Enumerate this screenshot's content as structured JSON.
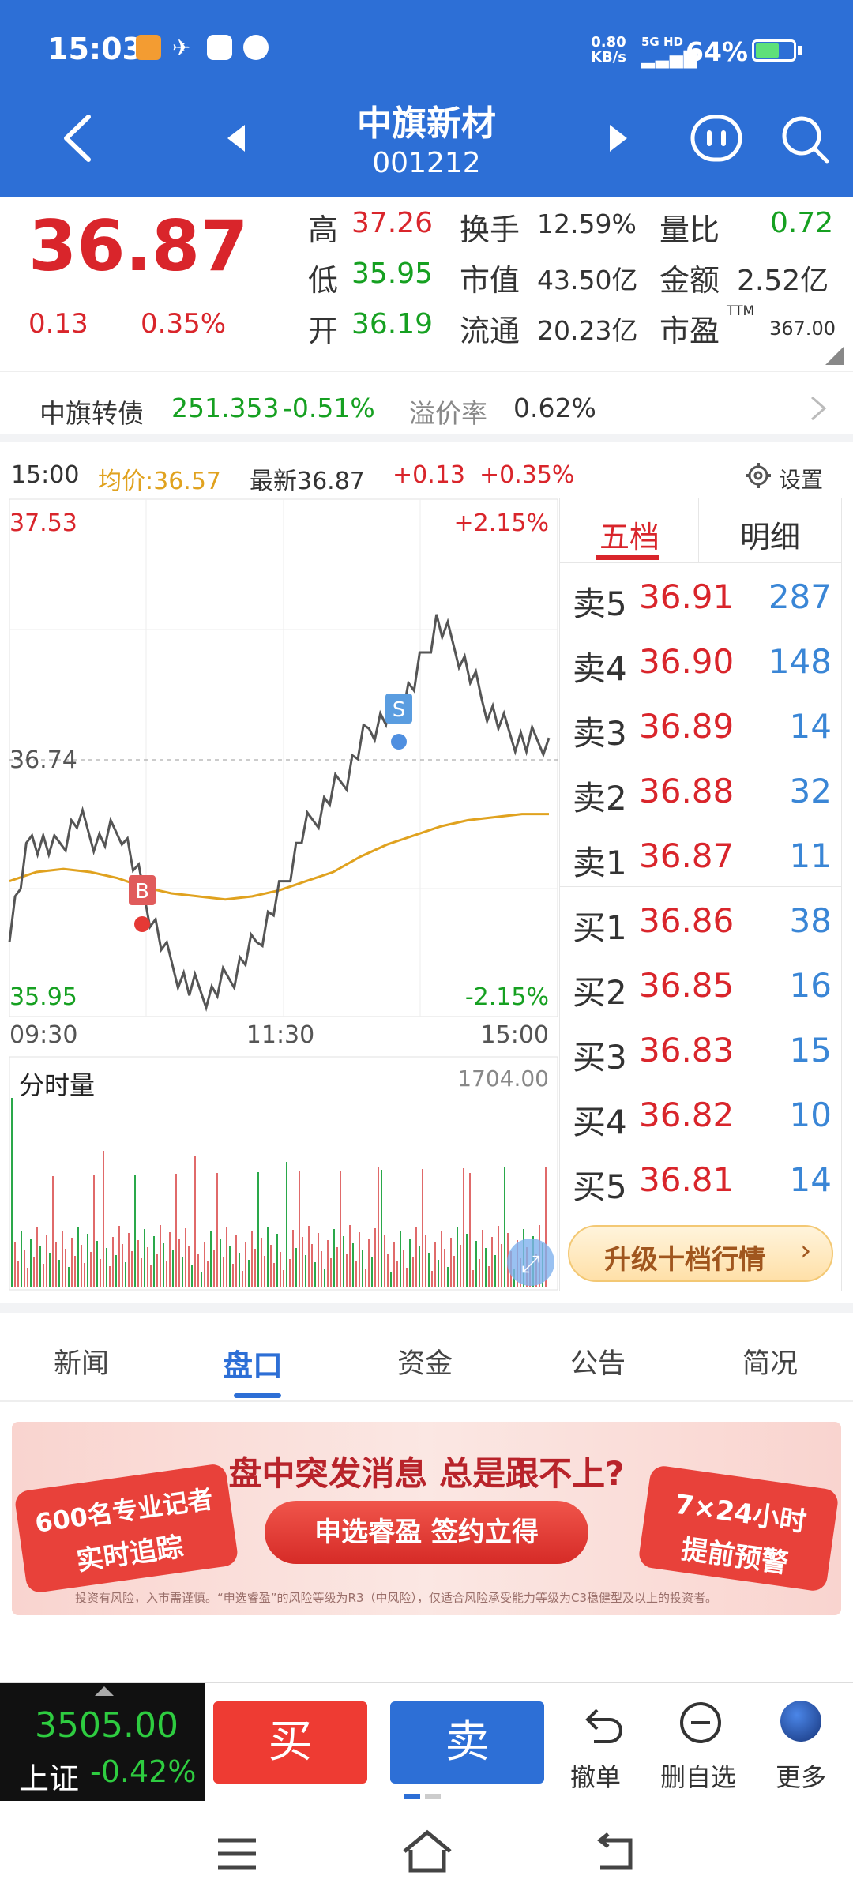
{
  "status_bar": {
    "time": "15:03",
    "net_speed_top": "0.80",
    "net_speed_unit": "KB/s",
    "network": "5G HD",
    "battery": "64%",
    "battery_level": 0.64
  },
  "nav": {
    "stock_name": "中旗新材",
    "stock_code": "001212"
  },
  "quote": {
    "price": "36.87",
    "change": "0.13",
    "change_pct": "0.35%",
    "high_label": "高",
    "high": "37.26",
    "low_label": "低",
    "low": "35.95",
    "open_label": "开",
    "open": "36.19",
    "turnover_label": "换手",
    "turnover": "12.59%",
    "mcap_label": "市值",
    "mcap": "43.50亿",
    "float_label": "流通",
    "float": "20.23亿",
    "volratio_label": "量比",
    "volratio": "0.72",
    "amount_label": "金额",
    "amount": "2.52亿",
    "pe_label": "市盈",
    "pe_sup": "TTM",
    "pe": "367.00"
  },
  "bond": {
    "name": "中旗转债",
    "price": "251.353",
    "pct": "-0.51%",
    "premium_label": "溢价率",
    "premium": "0.62%"
  },
  "chart_head": {
    "time": "15:00",
    "avg": "均价:36.57",
    "latest": "最新36.87",
    "chg": "+0.13",
    "pct": "+0.35%",
    "settings": "设置"
  },
  "chart": {
    "y_top": "37.53",
    "y_mid": "36.74",
    "y_bot": "35.95",
    "pct_top": "+2.15%",
    "pct_bot": "-2.15%",
    "x_start": "09:30",
    "x_mid": "11:30",
    "x_end": "15:00",
    "buy_marker": "B",
    "sell_marker": "S",
    "vol_label": "分时量",
    "vol_max": "1704.00"
  },
  "chart_data": {
    "type": "line",
    "series": [
      {
        "values": [
          36.2,
          36.5,
          36.45,
          36.55,
          36.48,
          36.52,
          36.3,
          36.1,
          36.0,
          35.98,
          36.05,
          36.15,
          36.3,
          36.5,
          36.6,
          36.7,
          36.85,
          36.9,
          37.0,
          37.2,
          37.1,
          36.95,
          36.85,
          36.8,
          36.82
        ]
      },
      {
        "values": [
          36.35,
          36.38,
          36.39,
          36.38,
          36.36,
          36.33,
          36.31,
          36.3,
          36.29,
          36.3,
          36.32,
          36.35,
          36.38,
          36.43,
          36.47,
          36.5,
          36.53,
          36.55,
          36.56,
          36.57,
          36.57
        ]
      }
    ],
    "ylim": [
      35.95,
      37.53
    ]
  },
  "orderbook": {
    "tab_active": "五档",
    "tab_other": "明细",
    "asks": [
      {
        "label": "卖5",
        "price": "36.91",
        "vol": "287"
      },
      {
        "label": "卖4",
        "price": "36.90",
        "vol": "148"
      },
      {
        "label": "卖3",
        "price": "36.89",
        "vol": "14"
      },
      {
        "label": "卖2",
        "price": "36.88",
        "vol": "32"
      },
      {
        "label": "卖1",
        "price": "36.87",
        "vol": "11"
      }
    ],
    "bids": [
      {
        "label": "买1",
        "price": "36.86",
        "vol": "38"
      },
      {
        "label": "买2",
        "price": "36.85",
        "vol": "16"
      },
      {
        "label": "买3",
        "price": "36.83",
        "vol": "15"
      },
      {
        "label": "买4",
        "price": "36.82",
        "vol": "10"
      },
      {
        "label": "买5",
        "price": "36.81",
        "vol": "14"
      }
    ],
    "upgrade": "升级十档行情"
  },
  "tabs": [
    "新闻",
    "盘口",
    "资金",
    "公告",
    "简况"
  ],
  "banner": {
    "headline": "盘中突发消息 总是跟不上?",
    "left_badge1": "600名专业记者",
    "left_badge2": "实时追踪",
    "cta": "申选睿盈 签约立得",
    "right_badge1": "7×24小时",
    "right_badge2": "提前预警",
    "disclaimer": "投资有风险，入市需谨慎。“申选睿盈”的风险等级为R3（中风险），仅适合风险承受能力等级为C3稳健型及以上的投资者。"
  },
  "bottom": {
    "index_value": "3505.00",
    "index_name": "上证",
    "index_pct": "-0.42%",
    "buy": "买",
    "sell": "卖",
    "cancel": "撤单",
    "remove": "删自选",
    "more": "更多"
  }
}
